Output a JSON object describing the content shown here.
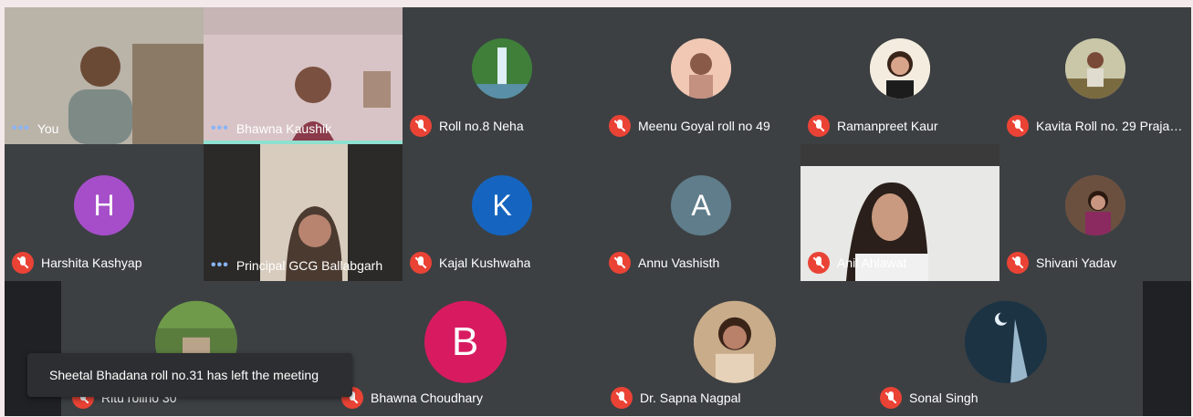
{
  "participants": [
    {
      "name": "You",
      "type": "video",
      "indicator": "dots"
    },
    {
      "name": "Bhawna Kaushik",
      "type": "video",
      "indicator": "dots",
      "speaking": true
    },
    {
      "name": "Roll no.8 Neha",
      "type": "photo",
      "indicator": "mute",
      "avatar_color": "#2e7d32"
    },
    {
      "name": "Meenu Goyal roll no 49",
      "type": "photo",
      "indicator": "mute",
      "avatar_color": "#e8b49a"
    },
    {
      "name": "Ramanpreet Kaur",
      "type": "photo",
      "indicator": "mute",
      "avatar_color": "#f2e8d8"
    },
    {
      "name": "Kavita Roll no. 29 Prajap...",
      "type": "photo",
      "indicator": "mute",
      "avatar_color": "#c9c2a8"
    },
    {
      "name": "Harshita Kashyap",
      "type": "letter",
      "letter": "H",
      "indicator": "mute",
      "avatar_color": "#a64ec9"
    },
    {
      "name": "Principal GCG Ballabgarh",
      "type": "video",
      "indicator": "dots"
    },
    {
      "name": "Kajal Kushwaha",
      "type": "letter",
      "letter": "K",
      "indicator": "mute",
      "avatar_color": "#1565c0"
    },
    {
      "name": "Annu Vashisth",
      "type": "letter",
      "letter": "A",
      "indicator": "mute",
      "avatar_color": "#607d8b"
    },
    {
      "name": "Anil Ahlawat",
      "type": "video",
      "indicator": "mute"
    },
    {
      "name": "Shivani Yadav",
      "type": "photo",
      "indicator": "mute",
      "avatar_color": "#8d6e63"
    },
    {
      "name": "Ritu rollno 30",
      "type": "photo",
      "indicator": "mute",
      "avatar_color": "#4e7a3a"
    },
    {
      "name": "Bhawna Choudhary",
      "type": "letter",
      "letter": "B",
      "indicator": "mute",
      "avatar_color": "#d81b60"
    },
    {
      "name": "Dr. Sapna Nagpal",
      "type": "photo",
      "indicator": "mute",
      "avatar_color": "#b58f6a"
    },
    {
      "name": "Sonal Singh",
      "type": "photo",
      "indicator": "mute",
      "avatar_color": "#1f3b4d"
    }
  ],
  "toast": "Sheetal Bhadana roll no.31 has left the meeting"
}
